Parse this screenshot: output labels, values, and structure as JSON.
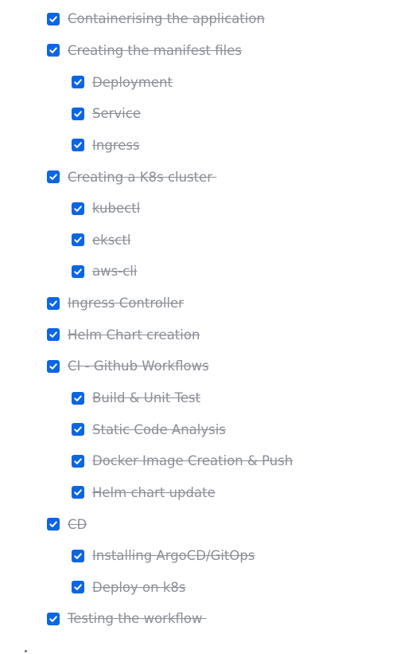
{
  "colors": {
    "checkbox": "#0c66e4",
    "completed_text": "#8c8f97"
  },
  "icons": {
    "checkbox": "checkmark-icon"
  },
  "tasks": [
    {
      "label": "Containerising the application",
      "level": 0,
      "checked": true
    },
    {
      "label": "Creating the manifest files",
      "level": 0,
      "checked": true
    },
    {
      "label": "Deployment",
      "level": 1,
      "checked": true
    },
    {
      "label": "Service",
      "level": 1,
      "checked": true
    },
    {
      "label": "Ingress",
      "level": 1,
      "checked": true
    },
    {
      "label": "Creating a K8s cluster ",
      "level": 0,
      "checked": true
    },
    {
      "label": "kubectl",
      "level": 1,
      "checked": true
    },
    {
      "label": "eksctl",
      "level": 1,
      "checked": true
    },
    {
      "label": "aws-cli",
      "level": 1,
      "checked": true
    },
    {
      "label": "Ingress Controller",
      "level": 0,
      "checked": true
    },
    {
      "label": "Helm Chart creation",
      "level": 0,
      "checked": true
    },
    {
      "label": "CI - Github Workflows",
      "level": 0,
      "checked": true
    },
    {
      "label": "Build & Unit Test",
      "level": 1,
      "checked": true
    },
    {
      "label": "Static Code Analysis",
      "level": 1,
      "checked": true
    },
    {
      "label": "Docker Image Creation & Push",
      "level": 1,
      "checked": true
    },
    {
      "label": "Helm chart update",
      "level": 1,
      "checked": true
    },
    {
      "label": "CD",
      "level": 0,
      "checked": true
    },
    {
      "label": "Installing ArgoCD/GitOps",
      "level": 1,
      "checked": true
    },
    {
      "label": "Deploy on k8s",
      "level": 1,
      "checked": true
    },
    {
      "label": "Testing the workflow ",
      "level": 0,
      "checked": true
    }
  ]
}
